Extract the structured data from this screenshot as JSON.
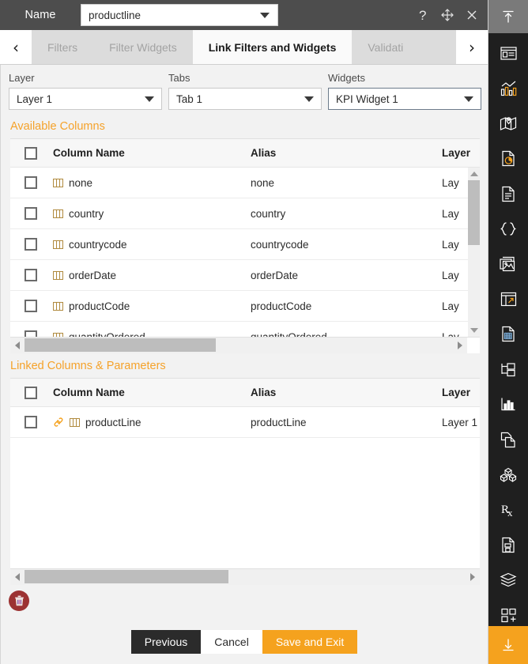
{
  "titlebar": {
    "name_label": "Name",
    "name_value": "productline",
    "help_icon": "question-mark-icon",
    "move_icon": "move-icon",
    "close_icon": "close-icon"
  },
  "tabs": {
    "prev_arrow": "‹",
    "next_arrow": "›",
    "items": [
      {
        "label": "Filters",
        "active": false
      },
      {
        "label": "Filter Widgets",
        "active": false
      },
      {
        "label": "Link Filters and Widgets",
        "active": true
      },
      {
        "label": "Validati",
        "active": false
      }
    ]
  },
  "selects": [
    {
      "label": "Layer",
      "value": "Layer 1",
      "focused": false
    },
    {
      "label": "Tabs",
      "value": "Tab 1",
      "focused": false
    },
    {
      "label": "Widgets",
      "value": "KPI Widget 1",
      "focused": true
    }
  ],
  "available": {
    "title": "Available Columns",
    "headers": {
      "column_name": "Column Name",
      "alias": "Alias",
      "layer": "Layer"
    },
    "rows": [
      {
        "name": "none",
        "alias": "none",
        "layer": "Lay"
      },
      {
        "name": "country",
        "alias": "country",
        "layer": "Lay"
      },
      {
        "name": "countrycode",
        "alias": "countrycode",
        "layer": "Lay"
      },
      {
        "name": "orderDate",
        "alias": "orderDate",
        "layer": "Lay"
      },
      {
        "name": "productCode",
        "alias": "productCode",
        "layer": "Lay"
      },
      {
        "name": "quantityOrdered",
        "alias": "quantityOrdered",
        "layer": "Lay"
      }
    ]
  },
  "linked": {
    "title": "Linked Columns & Parameters",
    "headers": {
      "column_name": "Column Name",
      "alias": "Alias",
      "layer": "Layer"
    },
    "rows": [
      {
        "name": "productLine",
        "alias": "productLine",
        "layer": "Layer 1",
        "linked": true
      }
    ]
  },
  "delete_button": {
    "icon": "trash-icon"
  },
  "footer": {
    "previous_label": "Previous",
    "cancel_label": "Cancel",
    "save_label": "Save and Exit"
  },
  "rail": {
    "top_icon": "collapse-up-icon",
    "bottom_icon": "expand-down-icon",
    "items": [
      "widget-panel-icon",
      "chart-icon",
      "map-icon",
      "report-pie-icon",
      "document-icon",
      "code-braces-icon",
      "images-icon",
      "dashboard-link-icon",
      "data-sheet-icon",
      "hierarchy-icon",
      "bar-analysis-icon",
      "copy-page-icon",
      "cubes-icon",
      "prescription-icon",
      "save-document-icon",
      "layers-icon",
      "add-widget-icon"
    ]
  },
  "colors": {
    "accent_orange": "#f5a21e",
    "titlebar_gray": "#4d4d4d",
    "rail_dark": "#1f1f1f",
    "delete_red": "#9c3232"
  }
}
